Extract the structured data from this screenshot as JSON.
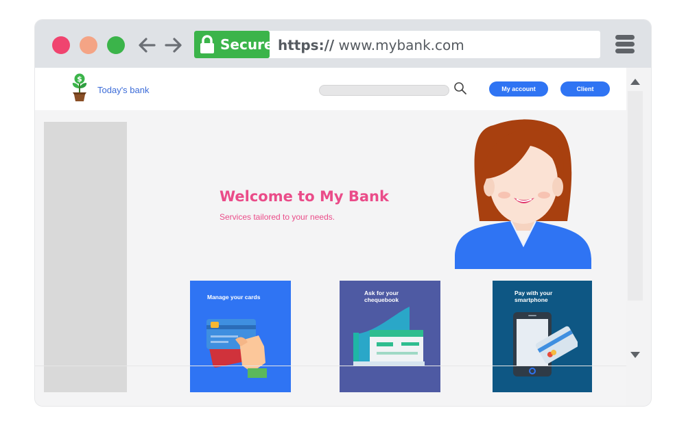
{
  "browser": {
    "secure_label": "Secure",
    "url_scheme": "https://",
    "url_host": "www.mybank.com",
    "dots": [
      "#f0446f",
      "#f4a485",
      "#3bb44a"
    ],
    "secure_color": "#3bb44a"
  },
  "header": {
    "brand": "Today's bank",
    "account_button": "My account",
    "client_button": "Client",
    "accent": "#2f74f3"
  },
  "hero": {
    "title": "Welcome to My Bank",
    "subtitle": "Services tailored to your needs.",
    "color": "#ea4c89"
  },
  "cards": [
    {
      "title": "Manage your cards",
      "icon": "credit-card-hand-icon",
      "color": "#2f74f3"
    },
    {
      "title": "Ask for your chequebook",
      "icon": "chequebook-icon",
      "color": "#4e5aa3"
    },
    {
      "title": "Pay with your smartphone",
      "icon": "smartphone-payment-icon",
      "color": "#0e5784"
    }
  ]
}
